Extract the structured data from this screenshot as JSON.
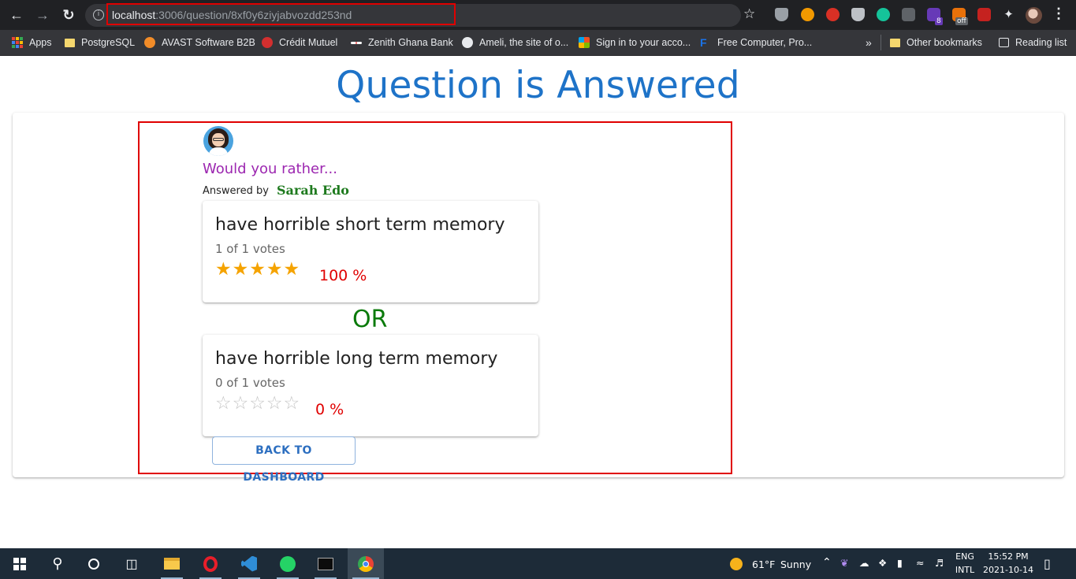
{
  "browser": {
    "url_host": "localhost",
    "url_path": ":3006/question/8xf0y6ziyjabvozdd253nd",
    "ext_badge_count": "8",
    "ext_badge_off": "off"
  },
  "bookmarks": [
    {
      "label": "Apps"
    },
    {
      "label": "PostgreSQL"
    },
    {
      "label": "AVAST Software B2B"
    },
    {
      "label": "Crédit Mutuel"
    },
    {
      "label": "Zenith Ghana Bank"
    },
    {
      "label": "Ameli, the site of o..."
    },
    {
      "label": "Sign in to your acco..."
    },
    {
      "label": "Free Computer, Pro..."
    }
  ],
  "bookmarks_overflow": "»",
  "other_bookmarks": "Other bookmarks",
  "reading_list": "Reading list",
  "page": {
    "title": "Question is Answered",
    "prompt": "Would you rather...",
    "answered_by_label": "Answered by",
    "author": "Sarah Edo",
    "or_label": "OR",
    "back_button": "BACK TO DASHBOARD"
  },
  "options": [
    {
      "text": "have horrible short term memory",
      "votes": "1 of 1 votes",
      "percent": "100 %",
      "stars_filled": 5,
      "stars_total": 5
    },
    {
      "text": "have horrible long term memory",
      "votes": "0 of 1 votes",
      "percent": "0 %",
      "stars_filled": 0,
      "stars_total": 5
    }
  ],
  "taskbar": {
    "weather_temp": "61°F",
    "weather_desc": "Sunny",
    "lang_top": "ENG",
    "lang_bottom": "INTL",
    "time": "15:52 PM",
    "date": "2021-10-14"
  },
  "colors": {
    "title": "#1e73c8",
    "prompt": "#9c27b0",
    "author": "#1e7a1e",
    "percent": "#e00000",
    "star_on": "#f5a300",
    "highlight_border": "#e00000"
  }
}
